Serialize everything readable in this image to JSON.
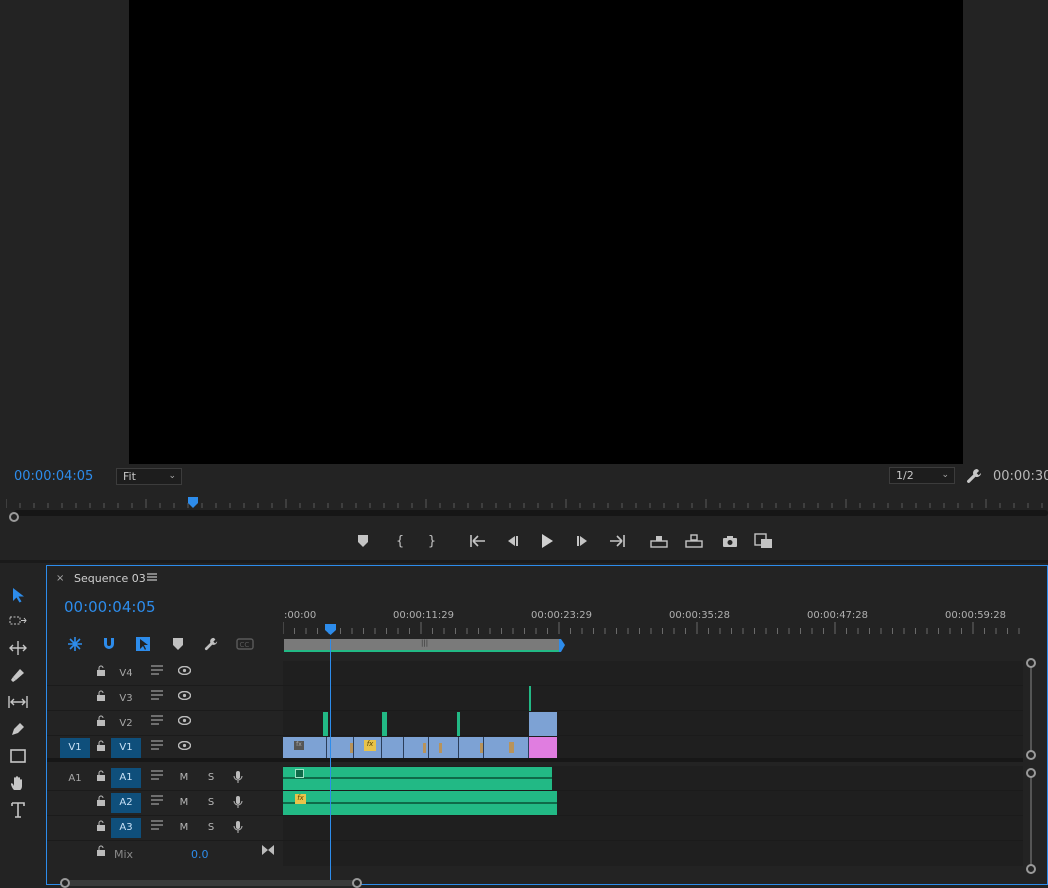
{
  "program_monitor": {
    "playhead_timecode": "00:00:04:05",
    "zoom": "Fit",
    "resolution": "1/2",
    "duration_timecode": "00:00:30",
    "playhead_position_fraction": 0.18
  },
  "transport": {
    "buttons": [
      "add-marker",
      "mark-in",
      "mark-out",
      "go-to-in",
      "step-back",
      "play",
      "step-forward",
      "go-to-out",
      "lift",
      "extract",
      "export-frame",
      "comparison-view"
    ]
  },
  "timeline": {
    "tab_close": "×",
    "sequence_name": "Sequence 03",
    "timecode": "00:00:04:05",
    "ruler_labels": [
      ":00:00",
      "00:00:11:29",
      "00:00:23:29",
      "00:00:35:28",
      "00:00:47:28",
      "00:00:59:28"
    ],
    "video_tracks": [
      {
        "name": "V4",
        "source": ""
      },
      {
        "name": "V3",
        "source": ""
      },
      {
        "name": "V2",
        "source": ""
      },
      {
        "name": "V1",
        "source": "V1"
      }
    ],
    "audio_tracks": [
      {
        "name": "A1",
        "source": "A1",
        "m": "M",
        "s": "S"
      },
      {
        "name": "A2",
        "source": "",
        "m": "M",
        "s": "S"
      },
      {
        "name": "A3",
        "source": "",
        "m": "M",
        "s": "S"
      }
    ],
    "mix": {
      "label": "Mix",
      "value": "0.0"
    },
    "fx_label": "fx"
  },
  "colors": {
    "accent": "#2d8ceb",
    "video_clip": "#7da2d4",
    "audio_clip": "#22b985",
    "pink_clip": "#e07de0",
    "track_target": "#0f4f7b"
  }
}
